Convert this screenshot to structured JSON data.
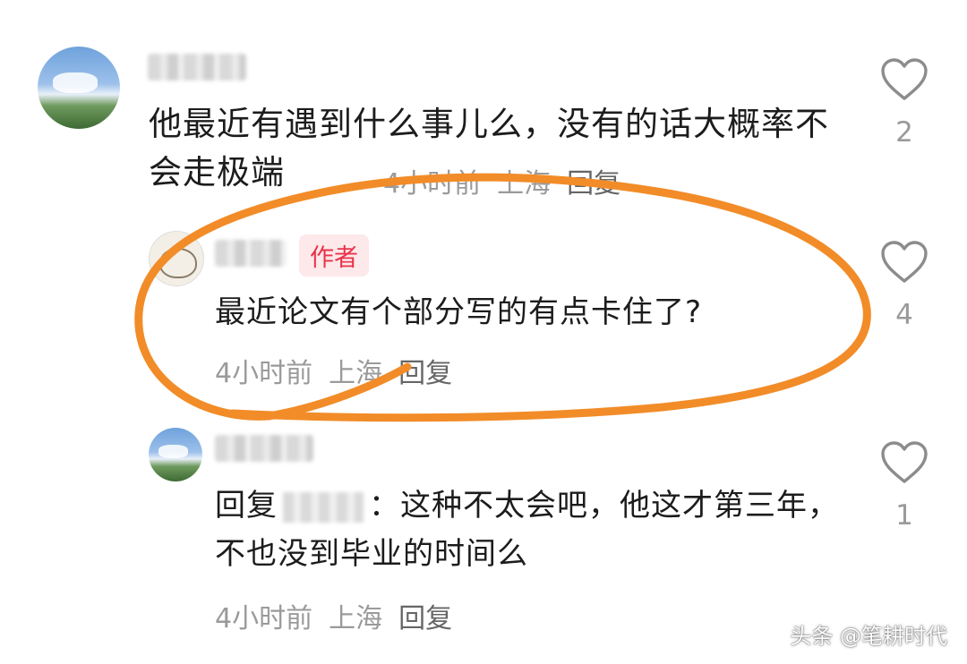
{
  "comments": [
    {
      "text": "他最近有遇到什么事儿么，没有的话大概率不会走极端",
      "time": "4小时前",
      "location": "上海",
      "reply_label": "回复",
      "likes": "2"
    },
    {
      "badge": "作者",
      "text": "最近论文有个部分写的有点卡住了?",
      "time": "4小时前",
      "location": "上海",
      "reply_label": "回复",
      "likes": "4"
    },
    {
      "reply_prefix": "回复",
      "text": "：这种不太会吧，他这才第三年，不也没到毕业的时间么",
      "time": "4小时前",
      "location": "上海",
      "reply_label": "回复",
      "likes": "1"
    }
  ],
  "watermark": "头条 @笔耕时代",
  "colors": {
    "annotation": "#f28c28",
    "badge_text": "#e8334a",
    "badge_bg": "#fde8ea",
    "meta": "#9a9a9a",
    "body_text": "#1c1c1c"
  },
  "icons": {
    "like": "heart-outline-icon"
  }
}
